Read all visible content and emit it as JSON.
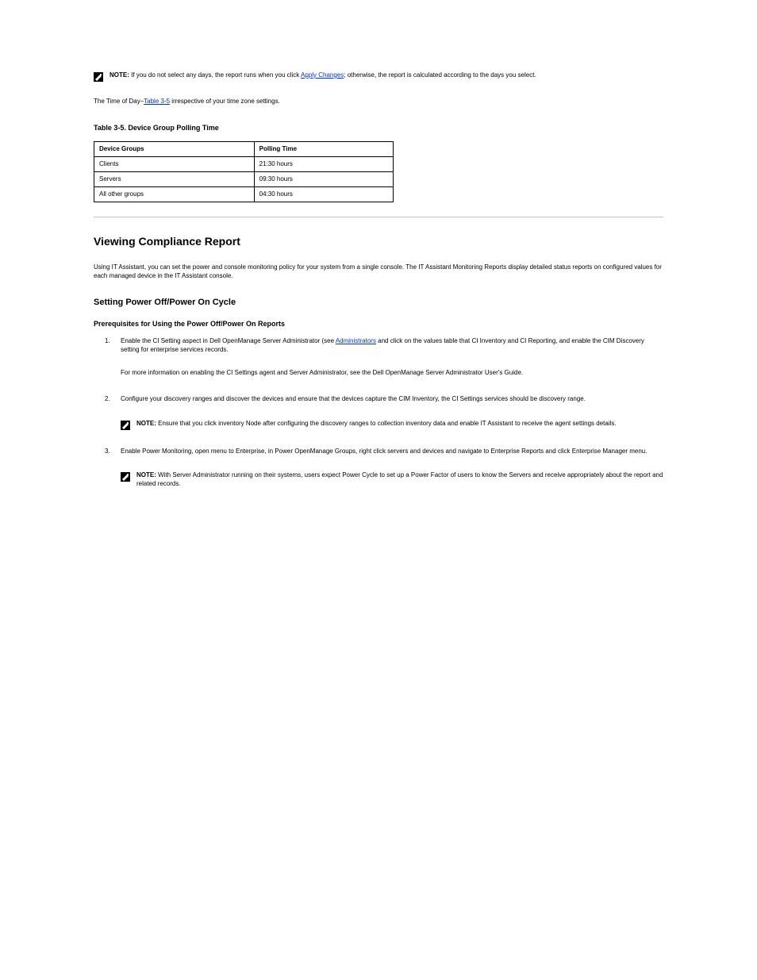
{
  "topNote": {
    "prefix": "NOTE:",
    "text_before_link": " If you do not select any days, the report runs when you click ",
    "text_after_link": "; otherwise, the report is calculated according to the days you select.",
    "link": "Apply Changes"
  },
  "pre_table": {
    "before": "The Time of Day–",
    "link": "Table 3-5",
    "after": " irrespective of your time zone settings."
  },
  "table_title": "Table 3-5.   Device Group Polling Time",
  "table": {
    "headers": [
      "Device Groups",
      "Polling Time"
    ],
    "rows": [
      [
        "Clients",
        "21:30 hours"
      ],
      [
        "Servers",
        "09:30 hours"
      ],
      [
        "All other groups",
        "04:30 hours"
      ]
    ]
  },
  "h2": "Viewing Compliance Report",
  "intro_para": "Using IT Assistant, you can set the power and console monitoring policy for your system from a single console. The IT Assistant Monitoring Reports display detailed status reports on configured values for each managed device in the IT Assistant console.",
  "h3": "Setting Power Off/Power On Cycle",
  "h4": "Prerequisites for Using the Power Off/Power On Reports",
  "steps": [
    {
      "main_before": "Enable the CI Setting aspect in Dell OpenManage Server Administrator (see ",
      "main_link_text": "Administrators",
      "main_after": " and click on the values table that CI Inventory and CI Reporting, and enable the CIM Discovery setting for enterprise services records.",
      "extra": "For more information on enabling the CI Settings agent and Server Administrator, see the Dell OpenManage Server Administrator User's Guide."
    },
    {
      "main": "Configure your discovery ranges and discover the devices and ensure that the devices capture the CIM Inventory, the CI Settings services should be discovery range.",
      "note": {
        "prefix": "NOTE:",
        "text": " Ensure that you click inventory Node after configuring the discovery ranges to collection inventory data and enable IT Assistant to receive the agent settings details."
      }
    },
    {
      "main": "Enable Power Monitoring, open menu to Enterprise, in Power OpenManage Groups, right click servers and devices and navigate to Enterprise Reports and click Enterprise Manager menu.",
      "note": {
        "prefix": "NOTE:",
        "text": " With Server Administrator running on their systems, users expect Power Cycle to set up a Power Factor of users to know the Servers and receive appropriately about the report and related records."
      }
    }
  ]
}
